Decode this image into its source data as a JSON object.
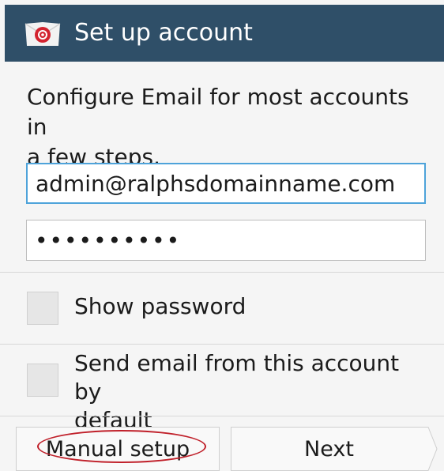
{
  "header": {
    "title": "Set up account",
    "icon": "email-app-icon",
    "bar_color": "#2f4f68"
  },
  "description": "Configure Email for most accounts in\na few steps.",
  "form": {
    "email_value": "admin@ralphsdomainname.com",
    "password_value": "••••••••••"
  },
  "options": {
    "show_password_label": "Show password",
    "default_send_label": "Send email from this account by\ndefault"
  },
  "buttons": {
    "manual_setup_label": "Manual setup",
    "next_label": "Next"
  },
  "accent_colors": {
    "focus_border": "#4ea3da",
    "annotation_oval": "#c0202a"
  }
}
